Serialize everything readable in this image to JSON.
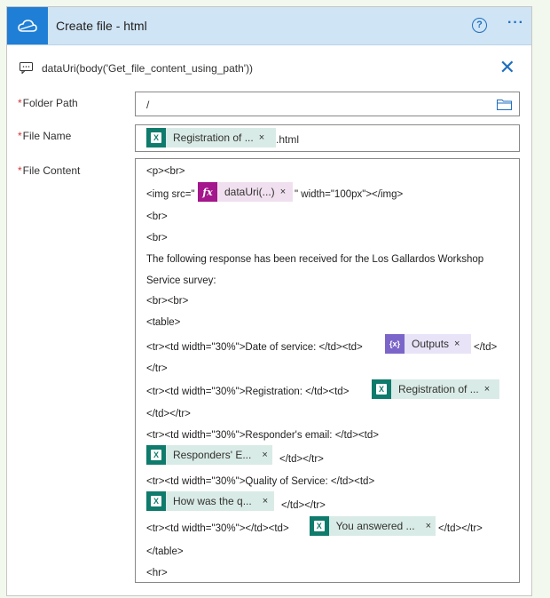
{
  "header": {
    "title": "Create file - html",
    "help_icon": "help-icon",
    "more_icon": "more-options-icon",
    "accent": "#1f7fd6"
  },
  "comment": {
    "text": "dataUri(body('Get_file_content_using_path'))"
  },
  "folder": {
    "label": "Folder Path",
    "required_mark": "*",
    "value": "/"
  },
  "filename": {
    "label": "File Name",
    "required_mark": "*",
    "token": "Registration of ...",
    "suffix": ".html"
  },
  "content": {
    "label": "File Content",
    "required_mark": "*",
    "l1": "<p><br>",
    "l2_pre": "<img src=\"",
    "l2_token": "dataUri(...)",
    "l2_post": "\" width=\"100px\"></img>",
    "l3": "<br>",
    "l4": "<br>",
    "l5": "The following response has been received for the Los Gallardos Workshop",
    "l6": "Service survey:",
    "l7": "<br><br>",
    "l8": "<table>",
    "l9_pre": "<tr><td width=\"30%\">Date of service: </td><td>",
    "l9_token": "Outputs",
    "l9_post": "</td>",
    "l10": "</tr>",
    "l11_pre": "<tr><td width=\"30%\">Registration: </td><td>",
    "l11_token": "Registration of ...",
    "l12": "</td></tr>",
    "l13": "<tr><td width=\"30%\">Responder's email: </td><td>",
    "l14_token": "Responders' E...",
    "l14_post": "</td></tr>",
    "l15": "<tr><td width=\"30%\">Quality of Service: </td><td>",
    "l16_token": "How was the q...",
    "l16_post": "</td></tr>",
    "l17_pre": "<tr><td width=\"30%\"></td><td>",
    "l17_token": "You answered ...",
    "l17_post": "</td></tr>",
    "l18": "</table>",
    "l19": "<hr>"
  },
  "token_close": "×",
  "icons": {
    "excel": "X",
    "fx": "fx",
    "var": "{x}"
  }
}
